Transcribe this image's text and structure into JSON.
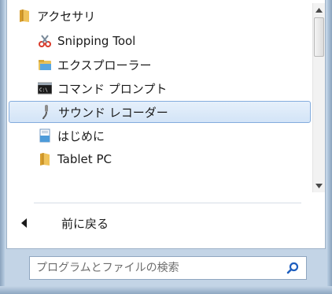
{
  "programs": {
    "folder": {
      "label": "アクセサリ",
      "icon": "folder-icon"
    },
    "items": [
      {
        "label": "Snipping Tool",
        "icon": "scissors-icon"
      },
      {
        "label": "エクスプローラー",
        "icon": "explorer-folder-icon"
      },
      {
        "label": "コマンド プロンプト",
        "icon": "command-prompt-icon"
      },
      {
        "label": "サウンド レコーダー",
        "icon": "microphone-icon",
        "selected": true
      },
      {
        "label": "はじめに",
        "icon": "getting-started-icon"
      },
      {
        "label": "Tablet PC",
        "icon": "folder-icon"
      }
    ]
  },
  "back": {
    "label": "前に戻る",
    "icon": "back-arrow-icon"
  },
  "search": {
    "placeholder": "プログラムとファイルの検索",
    "value": "",
    "icon": "magnifier-icon"
  },
  "colors": {
    "selection_bg": "#d3e4f7",
    "selection_border": "#84acdd",
    "frame": "#c3d4e6",
    "folder_yellow": "#e8b84a",
    "search_icon_blue": "#1f5fbf"
  }
}
